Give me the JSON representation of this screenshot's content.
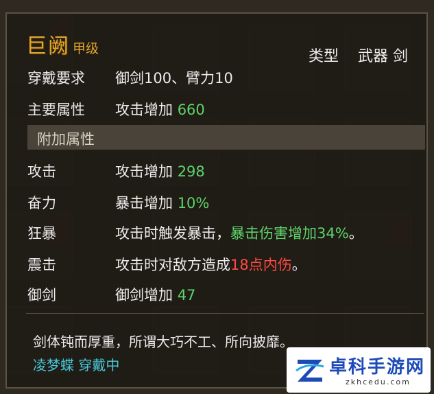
{
  "item": {
    "name": "巨阙",
    "grade": "甲级",
    "type_label": "类型",
    "type_value": "武器 剑"
  },
  "requirement": {
    "label": "穿戴要求",
    "value": "御剑100、臂力10"
  },
  "main_attr": {
    "label": "主要属性",
    "text": "攻击增加 ",
    "number": "660"
  },
  "extra_header": "附加属性",
  "attributes": [
    {
      "label": "攻击",
      "text": "攻击增加 ",
      "number": "298"
    },
    {
      "label": "奋力",
      "text": "暴击增加 ",
      "number": "10%"
    }
  ],
  "skills": [
    {
      "label": "狂暴",
      "text": "攻击时触发暴击，",
      "highlight": "暴击伤害增加34%",
      "tail": "。"
    },
    {
      "label": "震击",
      "text": "攻击时对敌方造成",
      "highlight": "18点内伤",
      "tail": "。"
    }
  ],
  "sword": {
    "label": "御剑",
    "text": "御剑增加 ",
    "number": "47"
  },
  "description": "剑体钝而厚重，所谓大巧不工、所向披靡。",
  "equipped_by": "凌梦蝶 穿戴中",
  "colors": {
    "title": "#e3a72a",
    "number_green": "#5fd36a",
    "damage_red": "#ff4a42",
    "equip_cyan": "#48c8d8"
  },
  "watermark": {
    "name": "卓科手游网",
    "url": "zkhcedu.com"
  }
}
